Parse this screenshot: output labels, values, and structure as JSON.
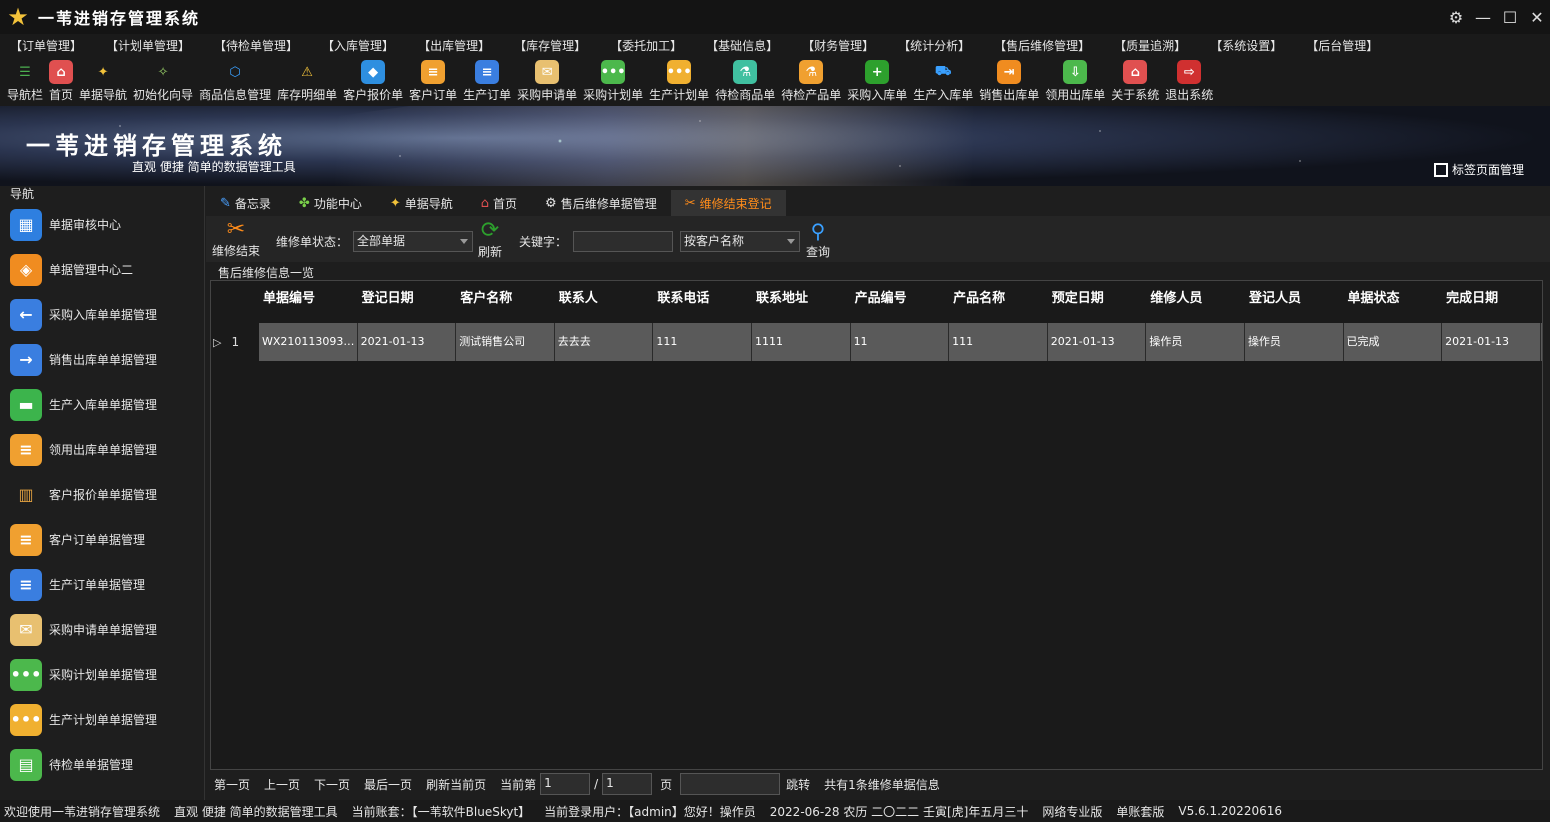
{
  "app": {
    "title": "一苇进销存管理系统"
  },
  "menus": [
    "【订单管理】",
    "【计划单管理】",
    "【待检单管理】",
    "【入库管理】",
    "【出库管理】",
    "【库存管理】",
    "【委托加工】",
    "【基础信息】",
    "【财务管理】",
    "【统计分析】",
    "【售后维修管理】",
    "【质量追溯】",
    "【系统设置】",
    "【后台管理】"
  ],
  "toolbar": [
    {
      "label": "导航栏",
      "icon": "menu-lines-icon",
      "color": "#1a1a1a",
      "glyph": "☰",
      "fg": "#4caf50"
    },
    {
      "label": "首页",
      "icon": "home-icon",
      "color": "#e05050",
      "glyph": "⌂"
    },
    {
      "label": "单据导航",
      "icon": "nav-pin-icon",
      "color": "#1a1a1a",
      "glyph": "✦",
      "fg": "#f2c23a"
    },
    {
      "label": "初始化向导",
      "icon": "magic-wand-icon",
      "color": "#1a1a1a",
      "glyph": "✧",
      "fg": "#9bd36a"
    },
    {
      "label": "商品信息管理",
      "icon": "cubes-icon",
      "color": "#1a1a1a",
      "glyph": "⬡",
      "fg": "#3aa0ff"
    },
    {
      "label": "库存明细单",
      "icon": "warning-icon",
      "color": "#1a1a1a",
      "glyph": "⚠",
      "fg": "#f2c23a"
    },
    {
      "label": "客户报价单",
      "icon": "tag-icon",
      "color": "#2e8fe0",
      "glyph": "◆"
    },
    {
      "label": "客户订单",
      "icon": "doc-orange-icon",
      "color": "#f0a030",
      "glyph": "≡"
    },
    {
      "label": "生产订单",
      "icon": "doc-blue-icon",
      "color": "#3a7ee0",
      "glyph": "≡"
    },
    {
      "label": "采购申请单",
      "icon": "envelope-icon",
      "color": "#e8c070",
      "glyph": "✉"
    },
    {
      "label": "采购计划单",
      "icon": "chat-green-icon",
      "color": "#4cb84c",
      "glyph": "•••"
    },
    {
      "label": "生产计划单",
      "icon": "chat-yellow-icon",
      "color": "#f0b030",
      "glyph": "•••"
    },
    {
      "label": "待检商品单",
      "icon": "flask-icon",
      "color": "#40c0a0",
      "glyph": "⚗"
    },
    {
      "label": "待检产品单",
      "icon": "beaker-icon",
      "color": "#f0a030",
      "glyph": "⚗"
    },
    {
      "label": "采购入库单",
      "icon": "plus-circle-icon",
      "color": "#2da02d",
      "glyph": "+"
    },
    {
      "label": "生产入库单",
      "icon": "hand-truck-icon",
      "color": "#1a1a1a",
      "glyph": "⛟",
      "fg": "#3aa0ff"
    },
    {
      "label": "销售出库单",
      "icon": "box-out-icon",
      "color": "#f08c20",
      "glyph": "⇥"
    },
    {
      "label": "领用出库单",
      "icon": "download-icon",
      "color": "#4cb84c",
      "glyph": "⇩"
    },
    {
      "label": "关于系统",
      "icon": "house-red-icon",
      "color": "#e05050",
      "glyph": "⌂"
    },
    {
      "label": "退出系统",
      "icon": "exit-icon",
      "color": "#d03030",
      "glyph": "⇨"
    }
  ],
  "banner": {
    "title": "一苇进销存管理系统",
    "subtitle": "直观  便捷  简单的数据管理工具",
    "tab_manager": "标签页面管理"
  },
  "nav": {
    "title": "导航",
    "items": [
      {
        "label": "单据审核中心",
        "icon": "grid-apps-icon",
        "color": "#2e7fe0",
        "glyph": "▦"
      },
      {
        "label": "单据管理中心二",
        "icon": "apps-orange-icon",
        "color": "#f08c20",
        "glyph": "◈"
      },
      {
        "label": "采购入库单单据管理",
        "icon": "arrow-left-icon",
        "color": "#3a7ee0",
        "glyph": "←"
      },
      {
        "label": "销售出库单单据管理",
        "icon": "arrow-right-icon",
        "color": "#3a7ee0",
        "glyph": "→"
      },
      {
        "label": "生产入库单单据管理",
        "icon": "folder-green-icon",
        "color": "#3cb44c",
        "glyph": "▬"
      },
      {
        "label": "领用出库单单据管理",
        "icon": "doc-orange-icon",
        "color": "#f0a030",
        "glyph": "≡"
      },
      {
        "label": "客户报价单单据管理",
        "icon": "books-icon",
        "color": "#1e1e1e",
        "glyph": "▥"
      },
      {
        "label": "客户订单单据管理",
        "icon": "doc-orange-icon",
        "color": "#f0a030",
        "glyph": "≡"
      },
      {
        "label": "生产订单单据管理",
        "icon": "doc-blue-icon",
        "color": "#3a7ee0",
        "glyph": "≡"
      },
      {
        "label": "采购申请单单据管理",
        "icon": "envelope-icon",
        "color": "#e8c070",
        "glyph": "✉"
      },
      {
        "label": "采购计划单单据管理",
        "icon": "chat-green-icon",
        "color": "#4cb84c",
        "glyph": "•••"
      },
      {
        "label": "生产计划单单据管理",
        "icon": "chat-yellow-icon",
        "color": "#f0b030",
        "glyph": "•••"
      },
      {
        "label": "待检单单据管理",
        "icon": "clipboard-green-icon",
        "color": "#4cb84c",
        "glyph": "▤"
      }
    ]
  },
  "tabs": [
    {
      "label": "备忘录",
      "icon": "memo-icon",
      "glyph": "✎",
      "color": "#4aa0ff"
    },
    {
      "label": "功能中心",
      "icon": "function-icon",
      "glyph": "✤",
      "color": "#7ad04a"
    },
    {
      "label": "单据导航",
      "icon": "nav-pin-icon",
      "glyph": "✦",
      "color": "#f2c23a"
    },
    {
      "label": "首页",
      "icon": "home-icon",
      "glyph": "⌂",
      "color": "#e05050"
    },
    {
      "label": "售后维修单据管理",
      "icon": "tools-icon",
      "glyph": "⚙",
      "color": "#e6e6e6"
    },
    {
      "label": "维修结束登记",
      "icon": "wrench-icon",
      "glyph": "✂",
      "color": "#ff8c1a",
      "active": true
    }
  ],
  "filter": {
    "finish_btn": "维修结束",
    "status_label": "维修单状态：",
    "status_value": "全部单据",
    "refresh_btn": "刷新",
    "keyword_label": "关键字：",
    "keyword_value": "",
    "search_by": "按客户名称",
    "search_btn": "查询"
  },
  "section_title": "售后维修信息一览",
  "grid": {
    "columns": [
      "单据编号",
      "登记日期",
      "客户名称",
      "联系人",
      "联系电话",
      "联系地址",
      "产品编号",
      "产品名称",
      "预定日期",
      "维修人员",
      "登记人员",
      "单据状态",
      "完成日期"
    ],
    "rows": [
      {
        "index": "1",
        "cells": [
          "WX2101130936...",
          "2021-01-13",
          "测试销售公司",
          "去去去",
          "111",
          "1111",
          "11",
          "111",
          "2021-01-13",
          "操作员",
          "操作员",
          "已完成",
          "2021-01-13"
        ]
      }
    ]
  },
  "pager": {
    "first": "第一页",
    "prev": "上一页",
    "next": "下一页",
    "last": "最后一页",
    "refresh": "刷新当前页",
    "current_label": "当前第",
    "current": "1",
    "sep": "/",
    "total": "1",
    "page_unit": "页",
    "jump_value": "",
    "jump": "跳转",
    "summary": "共有1条维修单据信息"
  },
  "status": [
    "欢迎使用一苇进销存管理系统",
    "直观  便捷  简单的数据管理工具",
    "当前账套：【一苇软件BlueSkyt】",
    "当前登录用户：【admin】您好！操作员",
    "2022-06-28  农历 二〇二二 壬寅[虎]年五月三十",
    "网络专业版",
    "单账套版",
    "V5.6.1.20220616"
  ]
}
